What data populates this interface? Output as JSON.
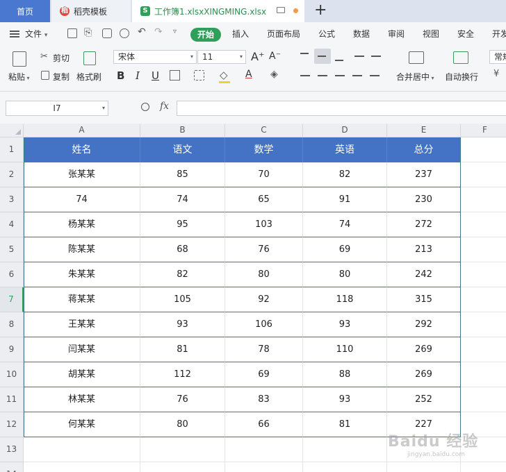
{
  "tabs": {
    "home": "首页",
    "template": "稻壳模板",
    "file": "工作簿1.xlsxXINGMING.xlsx",
    "template_icon": "daoke-logo-icon",
    "file_icon": "spreadsheet-file-icon"
  },
  "menu": {
    "file": "文件",
    "start": "开始",
    "items": [
      "插入",
      "页面布局",
      "公式",
      "数据",
      "审阅",
      "视图",
      "安全",
      "开发"
    ]
  },
  "ribbon": {
    "paste": "粘贴",
    "cut": "剪切",
    "copy": "复制",
    "format_painter": "格式刷",
    "font_name": "宋体",
    "font_size": "11",
    "bold": "B",
    "italic": "I",
    "underline": "U",
    "merge_center": "合并居中",
    "wrap_text": "自动换行",
    "number_format": "常规"
  },
  "formula_bar": {
    "name_box": "I7",
    "fx": "fx",
    "formula": ""
  },
  "columns": [
    "A",
    "B",
    "C",
    "D",
    "E",
    "F"
  ],
  "rows": [
    "1",
    "2",
    "3",
    "4",
    "5",
    "6",
    "7",
    "8",
    "9",
    "10",
    "11",
    "12",
    "13",
    "14"
  ],
  "active_row": "7",
  "table": {
    "headers": [
      "姓名",
      "语文",
      "数学",
      "英语",
      "总分"
    ],
    "rows": [
      [
        "张某某",
        "85",
        "70",
        "82",
        "237"
      ],
      [
        "74",
        "74",
        "65",
        "91",
        "230"
      ],
      [
        "杨某某",
        "95",
        "103",
        "74",
        "272"
      ],
      [
        "陈某某",
        "68",
        "76",
        "69",
        "213"
      ],
      [
        "朱某某",
        "82",
        "80",
        "80",
        "242"
      ],
      [
        "蒋某某",
        "105",
        "92",
        "118",
        "315"
      ],
      [
        "王某某",
        "93",
        "106",
        "93",
        "292"
      ],
      [
        "闫某某",
        "81",
        "78",
        "110",
        "269"
      ],
      [
        "胡某某",
        "112",
        "69",
        "88",
        "269"
      ],
      [
        "林某某",
        "76",
        "83",
        "93",
        "252"
      ],
      [
        "何某某",
        "80",
        "66",
        "81",
        "227"
      ]
    ]
  },
  "colors": {
    "header_fill": "#4472c4",
    "accent_green": "#2fa05a",
    "home_tab": "#4a78d0"
  },
  "watermark": {
    "text": "Baidu 经验",
    "sub": "jingyan.baidu.com"
  }
}
